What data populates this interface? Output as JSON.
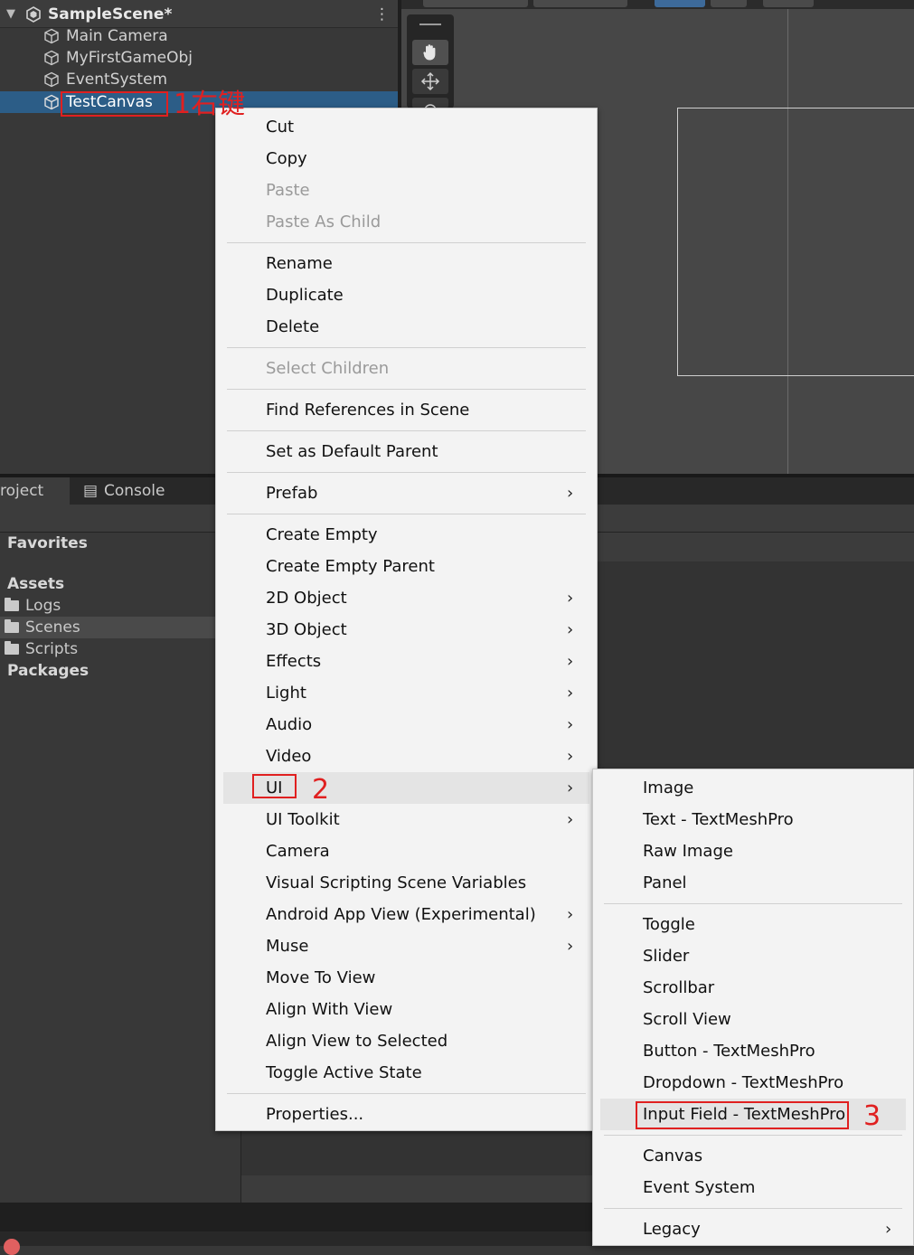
{
  "hierarchy": {
    "scene_name": "SampleScene*",
    "items": [
      {
        "label": "Main Camera"
      },
      {
        "label": "MyFirstGameObj"
      },
      {
        "label": "EventSystem"
      },
      {
        "label": "TestCanvas"
      }
    ],
    "menu_glyph": "⋮"
  },
  "project": {
    "tabs": [
      {
        "label": "roject"
      },
      {
        "label": "Console"
      }
    ],
    "tree": [
      {
        "label": "Favorites"
      },
      {
        "label": "Assets"
      },
      {
        "label": "Logs"
      },
      {
        "label": "Scenes"
      },
      {
        "label": "Scripts"
      },
      {
        "label": "Packages"
      }
    ]
  },
  "context_menu": {
    "items": [
      {
        "label": "Cut"
      },
      {
        "label": "Copy"
      },
      {
        "label": "Paste"
      },
      {
        "label": "Paste As Child"
      },
      {
        "label": "Rename"
      },
      {
        "label": "Duplicate"
      },
      {
        "label": "Delete"
      },
      {
        "label": "Select Children"
      },
      {
        "label": "Find References in Scene"
      },
      {
        "label": "Set as Default Parent"
      },
      {
        "label": "Prefab"
      },
      {
        "label": "Create Empty"
      },
      {
        "label": "Create Empty Parent"
      },
      {
        "label": "2D Object"
      },
      {
        "label": "3D Object"
      },
      {
        "label": "Effects"
      },
      {
        "label": "Light"
      },
      {
        "label": "Audio"
      },
      {
        "label": "Video"
      },
      {
        "label": "UI"
      },
      {
        "label": "UI Toolkit"
      },
      {
        "label": "Camera"
      },
      {
        "label": "Visual Scripting Scene Variables"
      },
      {
        "label": "Android App View (Experimental)"
      },
      {
        "label": "Muse"
      },
      {
        "label": "Move To View"
      },
      {
        "label": "Align With View"
      },
      {
        "label": "Align View to Selected"
      },
      {
        "label": "Toggle Active State"
      },
      {
        "label": "Properties..."
      }
    ],
    "submenu_arrow": "›"
  },
  "ui_submenu": {
    "items": [
      {
        "label": "Image"
      },
      {
        "label": "Text - TextMeshPro"
      },
      {
        "label": "Raw Image"
      },
      {
        "label": "Panel"
      },
      {
        "label": "Toggle"
      },
      {
        "label": "Slider"
      },
      {
        "label": "Scrollbar"
      },
      {
        "label": "Scroll View"
      },
      {
        "label": "Button - TextMeshPro"
      },
      {
        "label": "Dropdown - TextMeshPro"
      },
      {
        "label": "Input Field - TextMeshPro"
      },
      {
        "label": "Canvas"
      },
      {
        "label": "Event System"
      },
      {
        "label": "Legacy"
      }
    ]
  },
  "annotations": {
    "step1": "1右键",
    "step2": "2",
    "step3": "3",
    "color": "#e02020"
  },
  "colors": {
    "selection": "#2c5d87",
    "menu_bg": "#f3f3f3",
    "editor_bg": "#383838"
  }
}
